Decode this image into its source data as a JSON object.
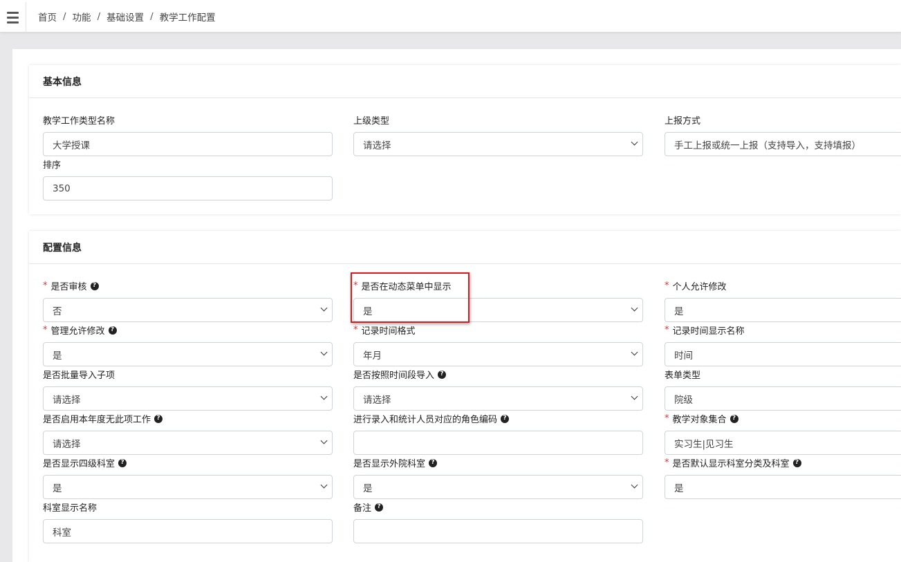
{
  "topbar": {
    "breadcrumb": [
      "首页",
      "功能",
      "基础设置",
      "教学工作配置"
    ],
    "separator": "/"
  },
  "basic": {
    "title": "基本信息",
    "type_name": {
      "label": "教学工作类型名称",
      "value": "大学授课"
    },
    "parent_type": {
      "label": "上级类型",
      "value": "请选择"
    },
    "report_mode": {
      "label": "上报方式",
      "value": "手工上报或统一上报（支持导入，支持填报）"
    },
    "sort": {
      "label": "排序",
      "value": "350"
    }
  },
  "config": {
    "title": "配置信息",
    "audit": {
      "label": "是否审核",
      "value": "否"
    },
    "dynamic_menu": {
      "label": "是否在动态菜单中显示",
      "value": "是"
    },
    "personal_edit": {
      "label": "个人允许修改",
      "value": "是"
    },
    "admin_edit": {
      "label": "管理允许修改",
      "value": "是"
    },
    "time_format": {
      "label": "记录时间格式",
      "value": "年月"
    },
    "time_display_name": {
      "label": "记录时间显示名称",
      "value": "时间"
    },
    "batch_import": {
      "label": "是否批量导入子项",
      "value": "请选择"
    },
    "period_import": {
      "label": "是否按照时间段导入",
      "value": "请选择"
    },
    "form_type": {
      "label": "表单类型",
      "value": "院级"
    },
    "no_item_this_year": {
      "label": "是否启用本年度无此项工作",
      "value": "请选择"
    },
    "role_code": {
      "label": "进行录入和统计人员对应的角色编码",
      "value": ""
    },
    "teaching_objects": {
      "label": "教学对象集合",
      "value": "实习生|见习生"
    },
    "level4_dept": {
      "label": "是否显示四级科室",
      "value": "是"
    },
    "external_dept": {
      "label": "是否显示外院科室",
      "value": "是"
    },
    "default_dept_category": {
      "label": "是否默认显示科室分类及科室",
      "value": "是"
    },
    "dept_display_name": {
      "label": "科室显示名称",
      "value": "科室"
    },
    "remark": {
      "label": "备注",
      "value": ""
    }
  },
  "required_mark": "*",
  "help_glyph": "?",
  "colors": {
    "highlight": "#e0161d",
    "required": "#dd3333"
  }
}
